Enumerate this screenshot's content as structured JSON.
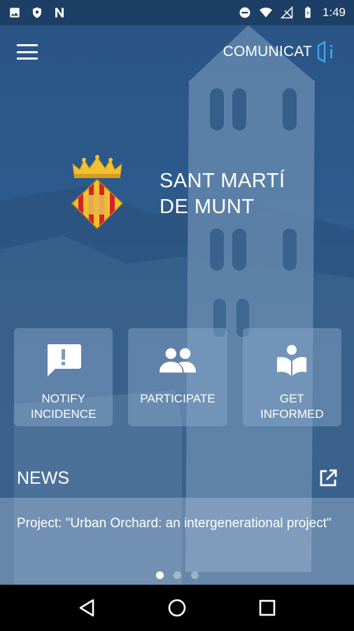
{
  "status_bar": {
    "time": "1:49",
    "left_icons": [
      "image-icon",
      "shield-icon",
      "n-icon"
    ],
    "right_icons": [
      "do-not-disturb-icon",
      "wifi-icon",
      "signal-icon",
      "battery-icon"
    ]
  },
  "header": {
    "menu_icon": "hamburger-menu-icon",
    "brand": "COMUNICAT",
    "brand_mark": "i"
  },
  "town": {
    "name_line1": "SANT MARTÍ",
    "name_line2": "DE MUNT"
  },
  "actions": [
    {
      "label": "NOTIFY\nINCIDENCE",
      "icon": "chat-alert-icon"
    },
    {
      "label": "PARTICIPATE",
      "icon": "people-icon"
    },
    {
      "label": "GET\nINFORMED",
      "icon": "book-reader-icon"
    }
  ],
  "news": {
    "title": "NEWS",
    "open_icon": "open-external-icon",
    "items": [
      "Project: \"Urban Orchard: an intergenerational project\""
    ],
    "pager": {
      "count": 3,
      "active": 0
    }
  },
  "colors": {
    "overlay": "#2d5a8c",
    "status_bar": "#1d3f66",
    "brand_accent": "#3fa0e8",
    "crest_red": "#d6202a",
    "crest_gold": "#f2c12e"
  },
  "nav": [
    "back-icon",
    "home-icon",
    "recents-icon"
  ]
}
